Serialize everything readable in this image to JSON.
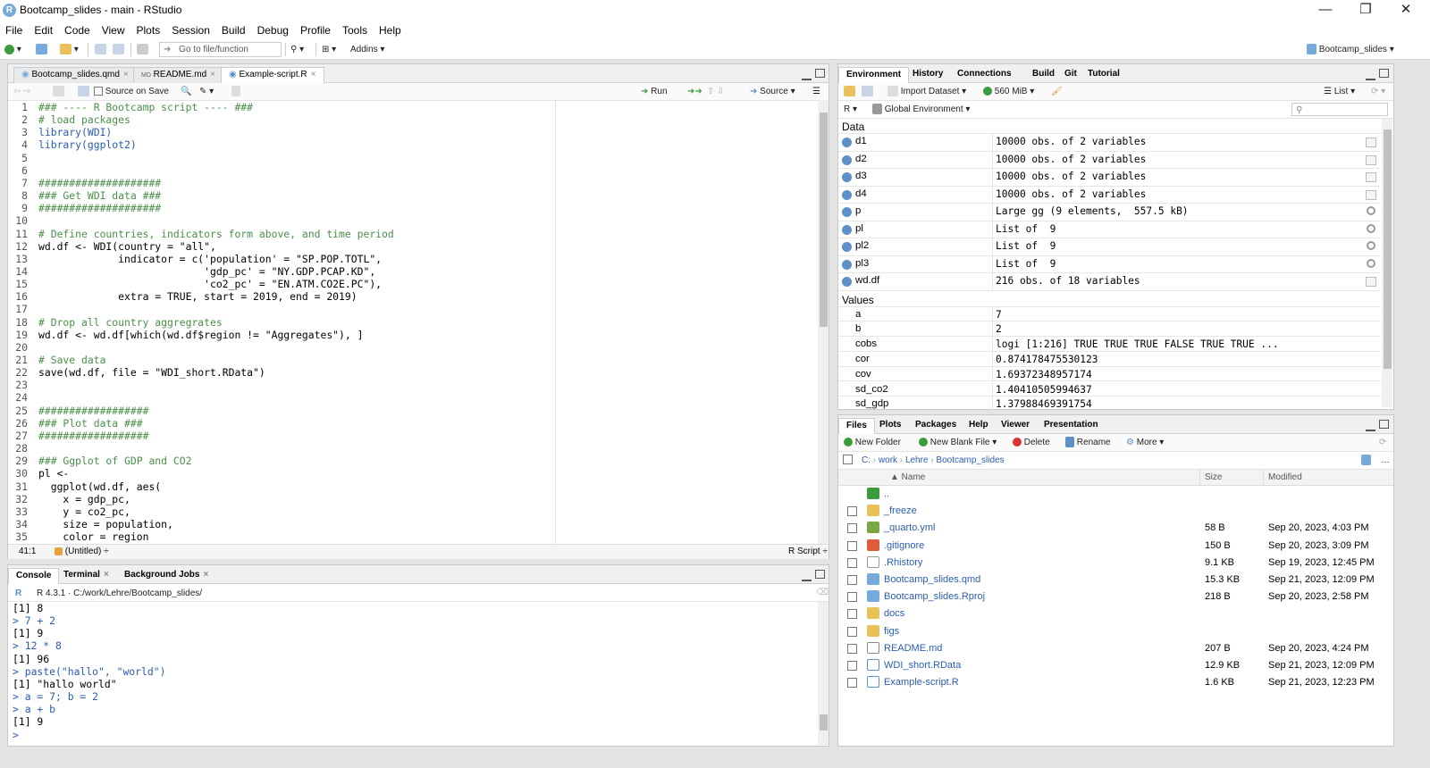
{
  "window": {
    "title": "Bootcamp_slides - main - RStudio",
    "min": "—",
    "restore": "❐",
    "close": "✕"
  },
  "menu": [
    "File",
    "Edit",
    "Code",
    "View",
    "Plots",
    "Session",
    "Build",
    "Debug",
    "Profile",
    "Tools",
    "Help"
  ],
  "toolbar": {
    "goto_placeholder": "Go to file/function",
    "addins": "Addins ▾",
    "project": "Bootcamp_slides ▾"
  },
  "editor": {
    "tabs": [
      {
        "label": "Bootcamp_slides.qmd",
        "close": "×"
      },
      {
        "label": "README.md",
        "close": "×"
      },
      {
        "label": "Example-script.R",
        "close": "×"
      }
    ],
    "source_on_save": "Source on Save",
    "run": "Run",
    "source": "Source",
    "lines": [
      {
        "n": "1",
        "t": "### ---- R Bootcamp script ---- ###",
        "c": "comment"
      },
      {
        "n": "2",
        "t": "# load packages",
        "c": "comment"
      },
      {
        "n": "3",
        "t": "library(WDI)",
        "c": "fn"
      },
      {
        "n": "4",
        "t": "library(ggplot2)",
        "c": "fn"
      },
      {
        "n": "5",
        "t": "",
        "c": ""
      },
      {
        "n": "6",
        "t": "",
        "c": ""
      },
      {
        "n": "7",
        "t": "####################",
        "c": "comment"
      },
      {
        "n": "8",
        "t": "### Get WDI data ###",
        "c": "comment"
      },
      {
        "n": "9",
        "t": "####################",
        "c": "comment"
      },
      {
        "n": "10",
        "t": "",
        "c": ""
      },
      {
        "n": "11",
        "t": "# Define countries, indicators form above, and time period",
        "c": "comment"
      },
      {
        "n": "12",
        "t": "wd.df <- WDI(country = \"all\",",
        "c": ""
      },
      {
        "n": "13",
        "t": "             indicator = c('population' = \"SP.POP.TOTL\",",
        "c": ""
      },
      {
        "n": "14",
        "t": "                           'gdp_pc' = \"NY.GDP.PCAP.KD\",",
        "c": ""
      },
      {
        "n": "15",
        "t": "                           'co2_pc' = \"EN.ATM.CO2E.PC\"),",
        "c": ""
      },
      {
        "n": "16",
        "t": "             extra = TRUE, start = 2019, end = 2019)",
        "c": ""
      },
      {
        "n": "17",
        "t": "",
        "c": ""
      },
      {
        "n": "18",
        "t": "# Drop all country aggregrates",
        "c": "comment"
      },
      {
        "n": "19",
        "t": "wd.df <- wd.df[which(wd.df$region != \"Aggregates\"), ]",
        "c": ""
      },
      {
        "n": "20",
        "t": "",
        "c": ""
      },
      {
        "n": "21",
        "t": "# Save data",
        "c": "comment"
      },
      {
        "n": "22",
        "t": "save(wd.df, file = \"WDI_short.RData\")",
        "c": ""
      },
      {
        "n": "23",
        "t": "",
        "c": ""
      },
      {
        "n": "24",
        "t": "",
        "c": ""
      },
      {
        "n": "25",
        "t": "##################",
        "c": "comment"
      },
      {
        "n": "26",
        "t": "### Plot data ###",
        "c": "comment"
      },
      {
        "n": "27",
        "t": "##################",
        "c": "comment"
      },
      {
        "n": "28",
        "t": "",
        "c": ""
      },
      {
        "n": "29",
        "t": "### Ggplot of GDP and CO2",
        "c": "comment"
      },
      {
        "n": "30",
        "t": "pl <-",
        "c": ""
      },
      {
        "n": "31",
        "t": "  ggplot(wd.df, aes(",
        "c": ""
      },
      {
        "n": "32",
        "t": "    x = gdp_pc,",
        "c": ""
      },
      {
        "n": "33",
        "t": "    y = co2_pc,",
        "c": ""
      },
      {
        "n": "34",
        "t": "    size = population,",
        "c": ""
      },
      {
        "n": "35",
        "t": "    color = region",
        "c": ""
      }
    ],
    "status_pos": "41:1",
    "status_scope": "(Untitled) ÷",
    "status_type": "R Script ÷"
  },
  "console": {
    "tabs": [
      {
        "label": "Console"
      },
      {
        "label": "Terminal",
        "close": "×"
      },
      {
        "label": "Background Jobs",
        "close": "×"
      }
    ],
    "version": "R 4.3.1 · C:/work/Lehre/Bootcamp_slides/",
    "lines": [
      {
        "t": "[1] 8",
        "c": "out"
      },
      {
        "t": "> 7 + 2",
        "c": "prompt"
      },
      {
        "t": "[1] 9",
        "c": "out"
      },
      {
        "t": "> 12 * 8",
        "c": "prompt"
      },
      {
        "t": "[1] 96",
        "c": "out"
      },
      {
        "t": "> paste(\"hallo\", \"world\")",
        "c": "prompt"
      },
      {
        "t": "[1] \"hallo world\"",
        "c": "out"
      },
      {
        "t": "> a = 7; b = 2",
        "c": "prompt"
      },
      {
        "t": "> a + b",
        "c": "prompt"
      },
      {
        "t": "[1] 9",
        "c": "out"
      },
      {
        "t": "> ",
        "c": "prompt"
      }
    ]
  },
  "env": {
    "tabs": [
      "Environment",
      "History",
      "Connections",
      "Build",
      "Git",
      "Tutorial"
    ],
    "import": "Import Dataset ▾",
    "memory": "560 MiB ▾",
    "view": "List ▾",
    "lang": "R ▾",
    "scope": "Global Environment ▾",
    "data_header": "Data",
    "values_header": "Values",
    "data": [
      {
        "name": "d1",
        "value": "10000 obs. of 2 variables",
        "icon": "grid"
      },
      {
        "name": "d2",
        "value": "10000 obs. of 2 variables",
        "icon": "grid"
      },
      {
        "name": "d3",
        "value": "10000 obs. of 2 variables",
        "icon": "grid"
      },
      {
        "name": "d4",
        "value": "10000 obs. of 2 variables",
        "icon": "grid"
      },
      {
        "name": "p",
        "value": "Large gg (9 elements,  557.5 kB)",
        "icon": "mag"
      },
      {
        "name": "pl",
        "value": "List of  9",
        "icon": "mag"
      },
      {
        "name": "pl2",
        "value": "List of  9",
        "icon": "mag"
      },
      {
        "name": "pl3",
        "value": "List of  9",
        "icon": "mag"
      },
      {
        "name": "wd.df",
        "value": "216 obs. of 18 variables",
        "icon": "grid"
      }
    ],
    "values": [
      {
        "name": "a",
        "value": "7"
      },
      {
        "name": "b",
        "value": "2"
      },
      {
        "name": "cobs",
        "value": "logi [1:216] TRUE TRUE TRUE FALSE TRUE TRUE ..."
      },
      {
        "name": "cor",
        "value": "0.874178475530123"
      },
      {
        "name": "cov",
        "value": "1.69372348957174"
      },
      {
        "name": "sd_co2",
        "value": "1.40410505994637"
      },
      {
        "name": "sd_gdp",
        "value": "1.37988469391754"
      }
    ]
  },
  "files": {
    "tabs": [
      "Files",
      "Plots",
      "Packages",
      "Help",
      "Viewer",
      "Presentation"
    ],
    "new_folder": "New Folder",
    "new_blank": "New Blank File ▾",
    "delete": "Delete",
    "rename": "Rename",
    "more": "More ▾",
    "crumbs": [
      "C:",
      "work",
      "Lehre",
      "Bootcamp_slides"
    ],
    "col_name": "▲ Name",
    "col_size": "Size",
    "col_mod": "Modified",
    "rows": [
      {
        "name": "..",
        "size": "",
        "mod": "",
        "type": "up"
      },
      {
        "name": "_freeze",
        "size": "",
        "mod": "",
        "type": "folder"
      },
      {
        "name": "_quarto.yml",
        "size": "58 B",
        "mod": "Sep 20, 2023, 4:03 PM",
        "type": "yml"
      },
      {
        "name": ".gitignore",
        "size": "150 B",
        "mod": "Sep 20, 2023, 3:09 PM",
        "type": "git"
      },
      {
        "name": ".Rhistory",
        "size": "9.1 KB",
        "mod": "Sep 19, 2023, 12:45 PM",
        "type": "hist"
      },
      {
        "name": "Bootcamp_slides.qmd",
        "size": "15.3 KB",
        "mod": "Sep 21, 2023, 12:09 PM",
        "type": "qmd"
      },
      {
        "name": "Bootcamp_slides.Rproj",
        "size": "218 B",
        "mod": "Sep 20, 2023, 2:58 PM",
        "type": "rproj"
      },
      {
        "name": "docs",
        "size": "",
        "mod": "",
        "type": "folder"
      },
      {
        "name": "figs",
        "size": "",
        "mod": "",
        "type": "folder"
      },
      {
        "name": "README.md",
        "size": "207 B",
        "mod": "Sep 20, 2023, 4:24 PM",
        "type": "md"
      },
      {
        "name": "WDI_short.RData",
        "size": "12.9 KB",
        "mod": "Sep 21, 2023, 12:09 PM",
        "type": "rdata"
      },
      {
        "name": "Example-script.R",
        "size": "1.6 KB",
        "mod": "Sep 21, 2023, 12:23 PM",
        "type": "rfile"
      }
    ]
  }
}
